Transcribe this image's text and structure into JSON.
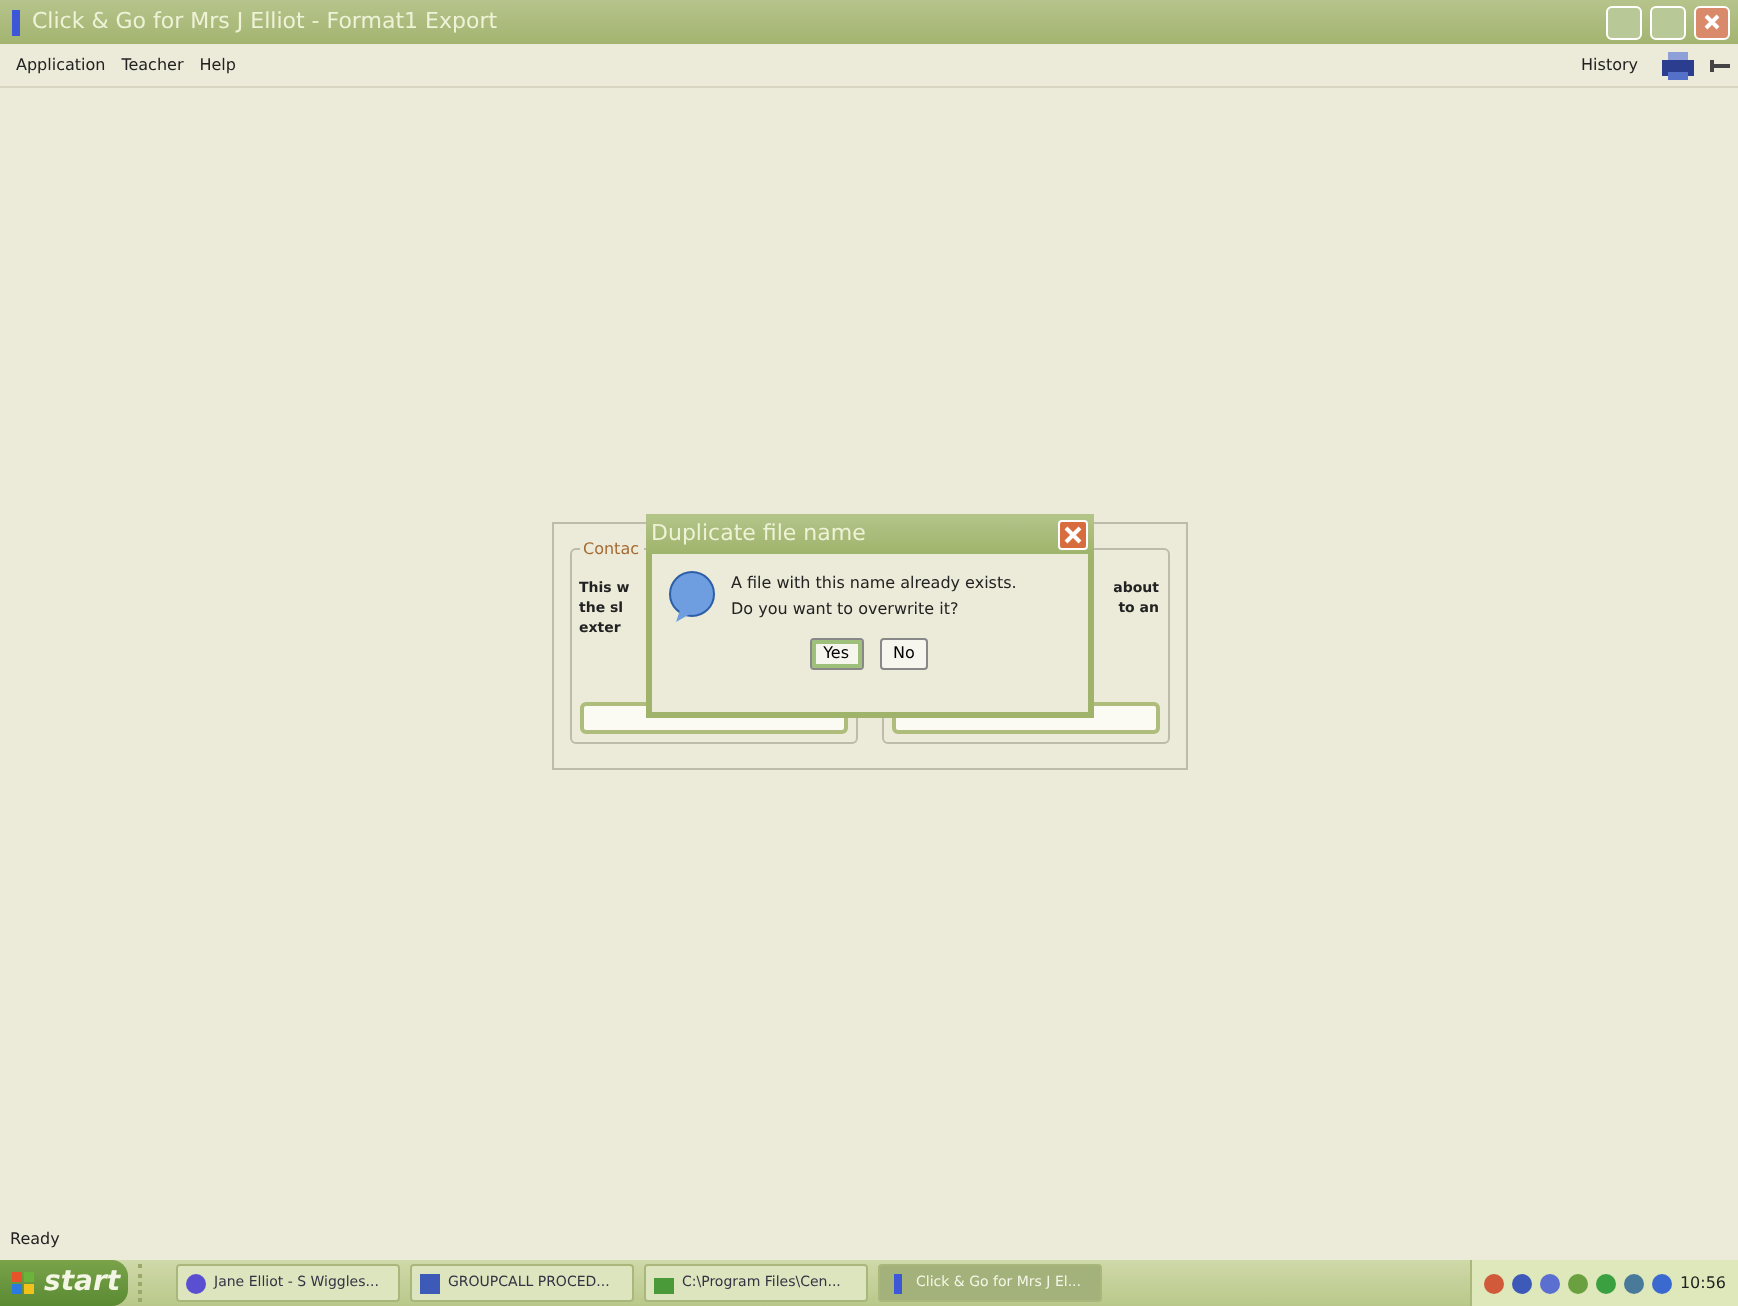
{
  "window": {
    "title": "Click & Go for Mrs J Elliot - Format1 Export"
  },
  "menu": [
    {
      "label": "Application"
    },
    {
      "label": "Teacher"
    },
    {
      "label": "Help"
    }
  ],
  "toolbar_right": {
    "label": "History"
  },
  "panels": [
    {
      "legend": "Contac",
      "lines": [
        "This w",
        "the sl",
        "exter"
      ]
    },
    {
      "lines": [
        "about",
        "to an"
      ]
    }
  ],
  "dialog": {
    "title": "Duplicate file name",
    "message": [
      "A file with this name already exists.",
      "Do you want to overwrite it?"
    ],
    "buttons": [
      {
        "label": "Yes",
        "selected": true
      },
      {
        "label": "No",
        "selected": false
      }
    ]
  },
  "status_bar": "Ready",
  "taskbar": {
    "start": "start",
    "tasks": [
      {
        "label": "Jane Elliot - S Wiggles...",
        "kind": "browser",
        "selected": false
      },
      {
        "label": "GROUPCALL PROCED...",
        "kind": "document",
        "selected": false
      },
      {
        "label": "C:\\Program Files\\Cen...",
        "kind": "folder",
        "selected": false
      },
      {
        "label": "Click & Go for Mrs J El...",
        "kind": "app",
        "selected": true
      }
    ],
    "clock": "10:56"
  }
}
